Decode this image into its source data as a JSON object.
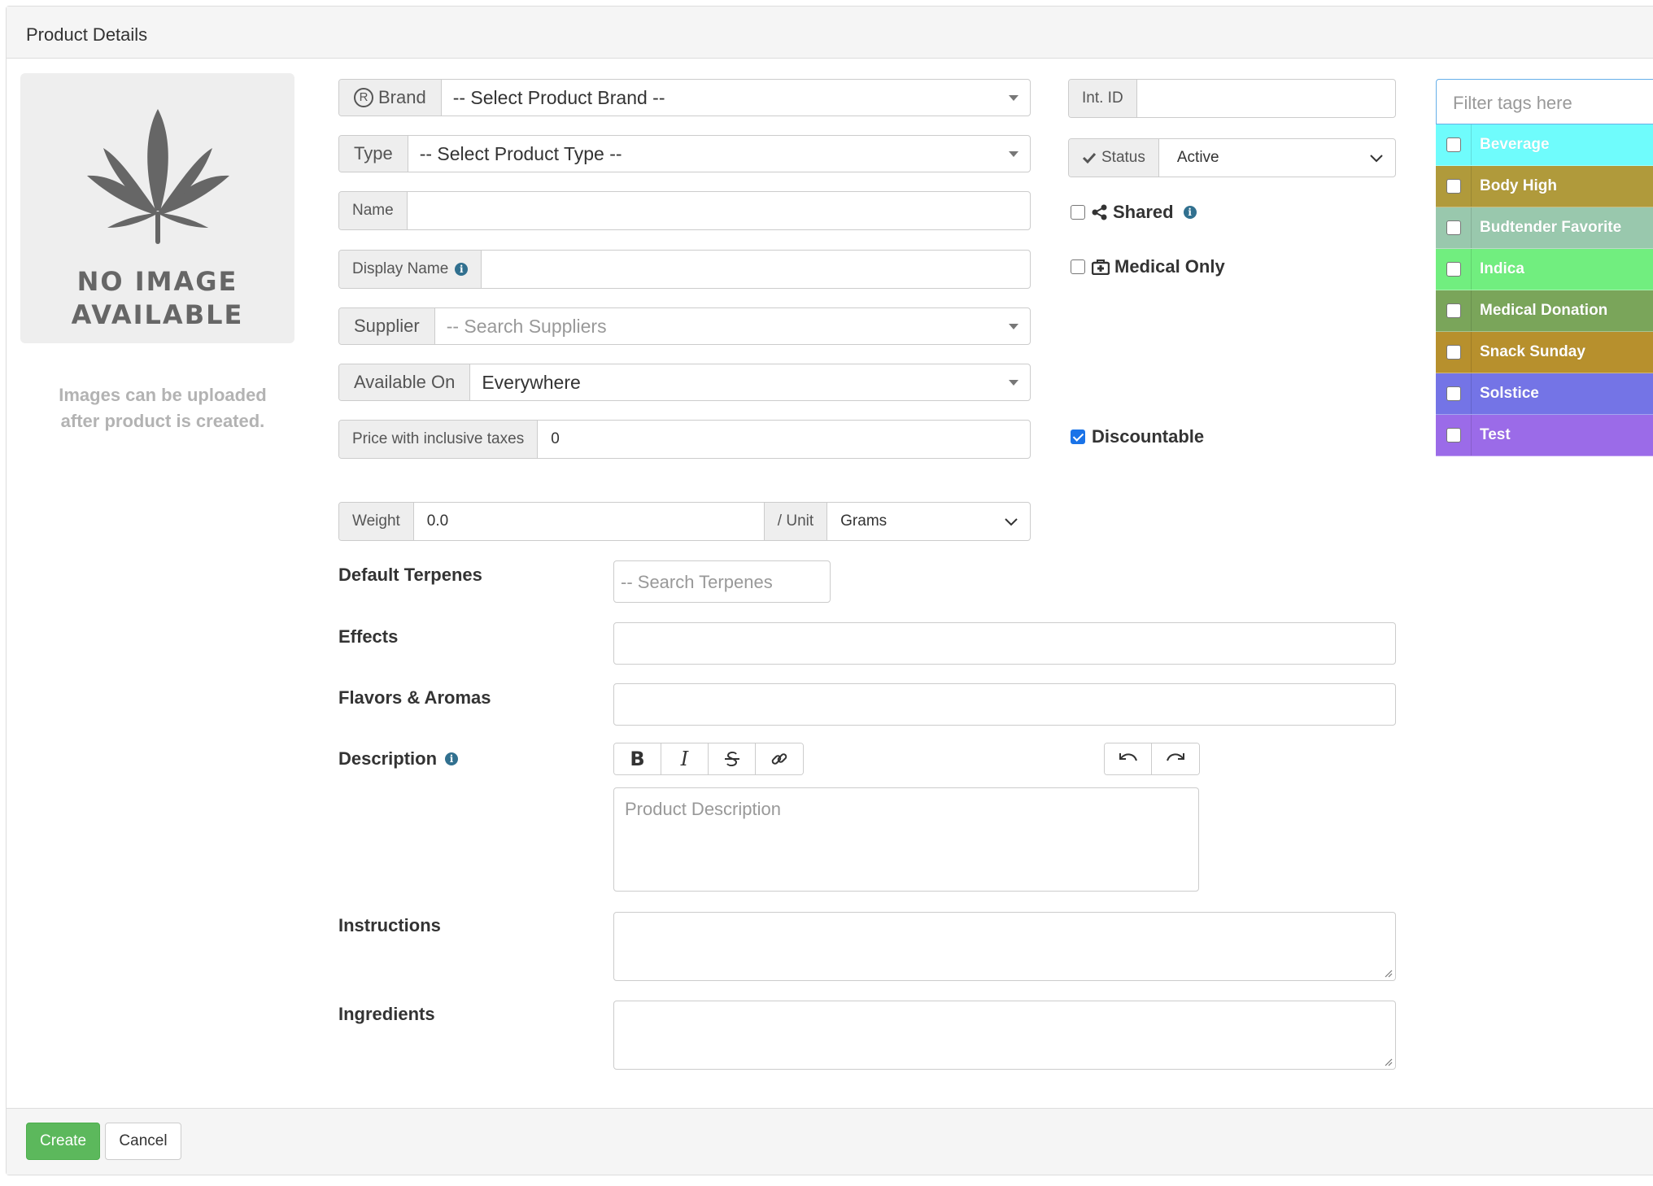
{
  "panel": {
    "title": "Product Details"
  },
  "image": {
    "no_image_line1": "NO IMAGE",
    "no_image_line2": "AVAILABLE",
    "hint_line1": "Images can be uploaded",
    "hint_line2": "after product is created."
  },
  "form": {
    "brand": {
      "label": "Brand",
      "value": "-- Select Product Brand --"
    },
    "type": {
      "label": "Type",
      "value": "-- Select Product Type --"
    },
    "name": {
      "label": "Name",
      "value": ""
    },
    "display_name": {
      "label": "Display Name",
      "value": ""
    },
    "supplier": {
      "label": "Supplier",
      "placeholder": "-- Search Suppliers"
    },
    "available_on": {
      "label": "Available On",
      "value": "Everywhere"
    },
    "price": {
      "label": "Price with inclusive taxes",
      "value": "0"
    },
    "weight": {
      "label": "Weight",
      "value": "0.0",
      "unit_label": "/ Unit",
      "unit_value": "Grams"
    },
    "int_id": {
      "label": "Int. ID",
      "value": ""
    },
    "status": {
      "label": "Status",
      "value": "Active"
    },
    "shared": {
      "label": "Shared",
      "checked": false
    },
    "medical_only": {
      "label": "Medical Only",
      "checked": false
    },
    "discountable": {
      "label": "Discountable",
      "checked": true
    },
    "default_terpenes": {
      "label": "Default Terpenes",
      "placeholder": "-- Search Terpenes"
    },
    "effects": {
      "label": "Effects"
    },
    "flavors": {
      "label": "Flavors & Aromas"
    },
    "description": {
      "label": "Description",
      "placeholder": "Product Description"
    },
    "instructions": {
      "label": "Instructions"
    },
    "ingredients": {
      "label": "Ingredients"
    }
  },
  "tags": {
    "filter_placeholder": "Filter tags here",
    "items": [
      {
        "label": "Beverage",
        "color": "#6ffcfc"
      },
      {
        "label": "Body High",
        "color": "#b09a3b"
      },
      {
        "label": "Budtender Favorite",
        "color": "#99c8ad"
      },
      {
        "label": "Indica",
        "color": "#71ee7f"
      },
      {
        "label": "Medical Donation",
        "color": "#7aa55a"
      },
      {
        "label": "Snack Sunday",
        "color": "#b7902d"
      },
      {
        "label": "Solstice",
        "color": "#7474e6"
      },
      {
        "label": "Test",
        "color": "#9b6be8"
      }
    ]
  },
  "footer": {
    "create_label": "Create",
    "cancel_label": "Cancel"
  },
  "colors": {
    "primary_success": "#5cb85c",
    "info": "#31708f"
  }
}
